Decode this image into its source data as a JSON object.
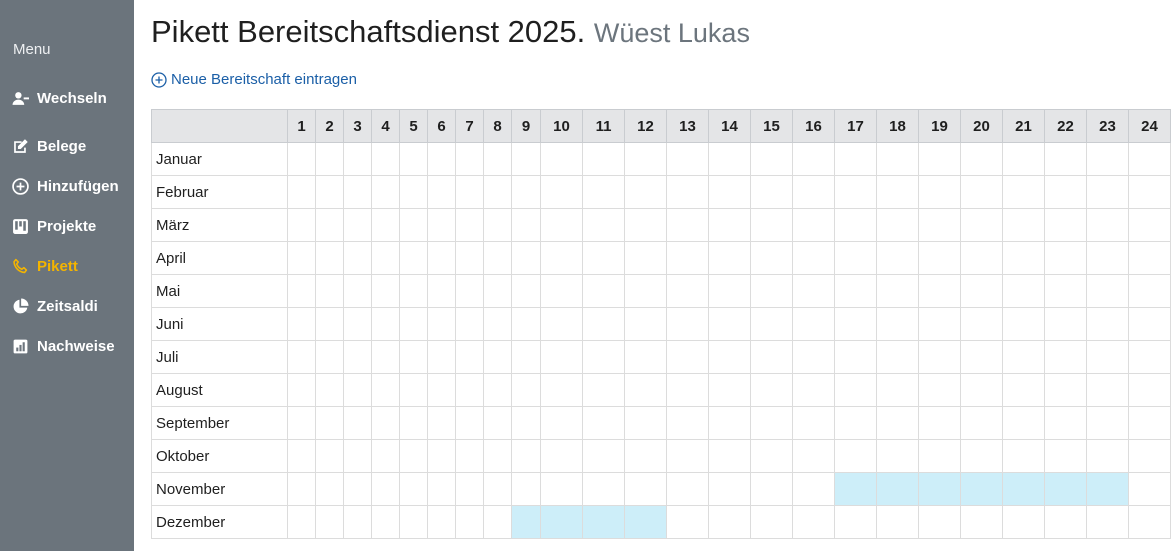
{
  "sidebar": {
    "menu_label": "Menu",
    "items": [
      {
        "label": "Wechseln",
        "icon": "user-swap-icon"
      },
      {
        "label": "Belege",
        "icon": "edit-icon"
      },
      {
        "label": "Hinzufügen",
        "icon": "plus-circle-icon"
      },
      {
        "label": "Projekte",
        "icon": "kanban-icon"
      },
      {
        "label": "Pikett",
        "icon": "phone-icon"
      },
      {
        "label": "Zeitsaldi",
        "icon": "pie-chart-icon"
      },
      {
        "label": "Nachweise",
        "icon": "bar-chart-icon"
      }
    ],
    "active_color": "#f4b400",
    "background_color": "#6b747c"
  },
  "header": {
    "title": "Pikett Bereitschaftsdienst 2025.",
    "user": "Wüest Lukas"
  },
  "actions": {
    "add_label": "Neue Bereitschaft eintragen"
  },
  "calendar": {
    "day_headers": [
      "1",
      "2",
      "3",
      "4",
      "5",
      "6",
      "7",
      "8",
      "9",
      "10",
      "11",
      "12",
      "13",
      "14",
      "15",
      "16",
      "17",
      "18",
      "19",
      "20",
      "21",
      "22",
      "23",
      "24"
    ],
    "months": [
      {
        "name": "Januar",
        "standby_days": []
      },
      {
        "name": "Februar",
        "standby_days": []
      },
      {
        "name": "März",
        "standby_days": []
      },
      {
        "name": "April",
        "standby_days": []
      },
      {
        "name": "Mai",
        "standby_days": []
      },
      {
        "name": "Juni",
        "standby_days": []
      },
      {
        "name": "Juli",
        "standby_days": []
      },
      {
        "name": "August",
        "standby_days": []
      },
      {
        "name": "September",
        "standby_days": []
      },
      {
        "name": "Oktober",
        "standby_days": []
      },
      {
        "name": "November",
        "standby_days": [
          17,
          18,
          19,
          20,
          21,
          22,
          23
        ]
      },
      {
        "name": "Dezember",
        "standby_days": [
          9,
          10,
          11,
          12
        ]
      }
    ],
    "highlight_color": "#cdeef9",
    "header_color": "#e4e5e7"
  }
}
